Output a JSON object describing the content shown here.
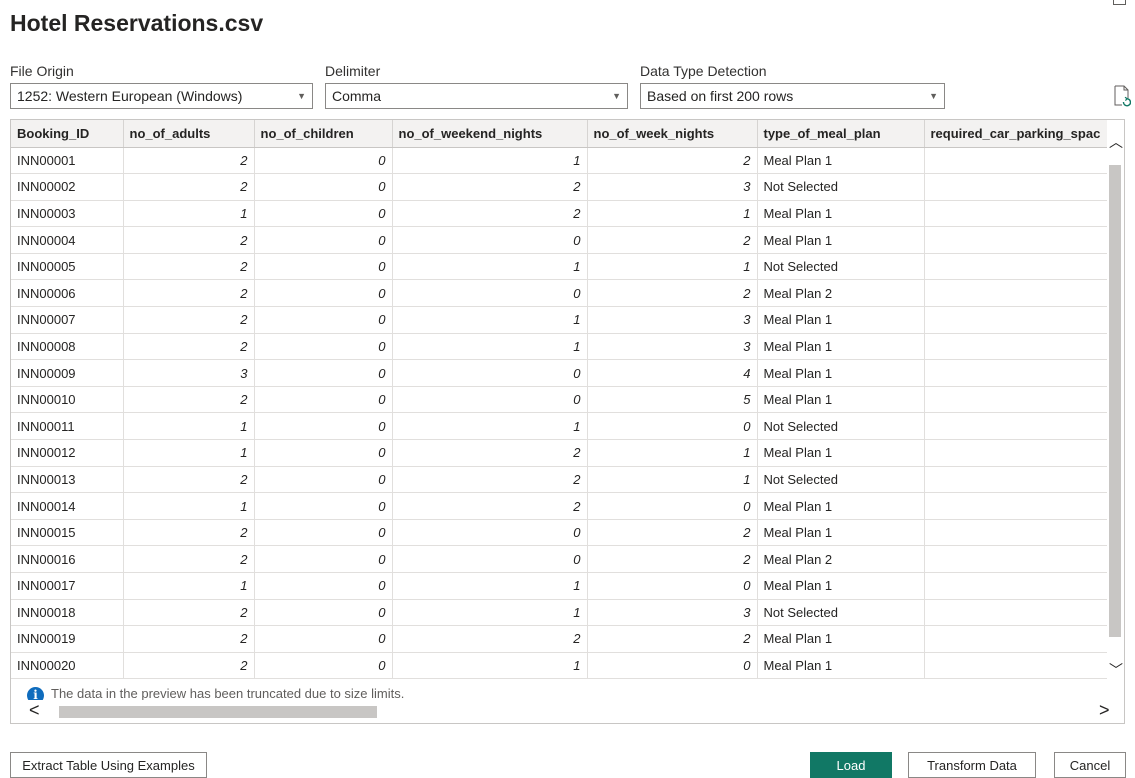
{
  "dialog": {
    "title": "Hotel Reservations.csv"
  },
  "options": {
    "file_origin": {
      "label": "File Origin",
      "value": "1252: Western European (Windows)"
    },
    "delimiter": {
      "label": "Delimiter",
      "value": "Comma"
    },
    "data_type_detection": {
      "label": "Data Type Detection",
      "value": "Based on first 200 rows"
    }
  },
  "table": {
    "columns": [
      "Booking_ID",
      "no_of_adults",
      "no_of_children",
      "no_of_weekend_nights",
      "no_of_week_nights",
      "type_of_meal_plan",
      "required_car_parking_spac"
    ],
    "rows": [
      [
        "INN00001",
        "2",
        "0",
        "1",
        "2",
        "Meal Plan 1",
        ""
      ],
      [
        "INN00002",
        "2",
        "0",
        "2",
        "3",
        "Not Selected",
        ""
      ],
      [
        "INN00003",
        "1",
        "0",
        "2",
        "1",
        "Meal Plan 1",
        ""
      ],
      [
        "INN00004",
        "2",
        "0",
        "0",
        "2",
        "Meal Plan 1",
        ""
      ],
      [
        "INN00005",
        "2",
        "0",
        "1",
        "1",
        "Not Selected",
        ""
      ],
      [
        "INN00006",
        "2",
        "0",
        "0",
        "2",
        "Meal Plan 2",
        ""
      ],
      [
        "INN00007",
        "2",
        "0",
        "1",
        "3",
        "Meal Plan 1",
        ""
      ],
      [
        "INN00008",
        "2",
        "0",
        "1",
        "3",
        "Meal Plan 1",
        ""
      ],
      [
        "INN00009",
        "3",
        "0",
        "0",
        "4",
        "Meal Plan 1",
        ""
      ],
      [
        "INN00010",
        "2",
        "0",
        "0",
        "5",
        "Meal Plan 1",
        ""
      ],
      [
        "INN00011",
        "1",
        "0",
        "1",
        "0",
        "Not Selected",
        ""
      ],
      [
        "INN00012",
        "1",
        "0",
        "2",
        "1",
        "Meal Plan 1",
        ""
      ],
      [
        "INN00013",
        "2",
        "0",
        "2",
        "1",
        "Not Selected",
        ""
      ],
      [
        "INN00014",
        "1",
        "0",
        "2",
        "0",
        "Meal Plan 1",
        ""
      ],
      [
        "INN00015",
        "2",
        "0",
        "0",
        "2",
        "Meal Plan 1",
        ""
      ],
      [
        "INN00016",
        "2",
        "0",
        "0",
        "2",
        "Meal Plan 2",
        ""
      ],
      [
        "INN00017",
        "1",
        "0",
        "1",
        "0",
        "Meal Plan 1",
        ""
      ],
      [
        "INN00018",
        "2",
        "0",
        "1",
        "3",
        "Not Selected",
        ""
      ],
      [
        "INN00019",
        "2",
        "0",
        "2",
        "2",
        "Meal Plan 1",
        ""
      ],
      [
        "INN00020",
        "2",
        "0",
        "1",
        "0",
        "Meal Plan 1",
        ""
      ]
    ]
  },
  "notice": {
    "text": "The data in the preview has been truncated due to size limits."
  },
  "buttons": {
    "extract": "Extract Table Using Examples",
    "load": "Load",
    "transform": "Transform Data",
    "cancel": "Cancel"
  },
  "icons": {
    "restore": "restore-window-icon",
    "refresh": "refresh-preview-icon",
    "info": "info-icon",
    "dropdown": "chevron-down-icon"
  },
  "colors": {
    "primary_button": "#117865",
    "info": "#0f6cbd",
    "header_bg": "#f3f2f1"
  }
}
